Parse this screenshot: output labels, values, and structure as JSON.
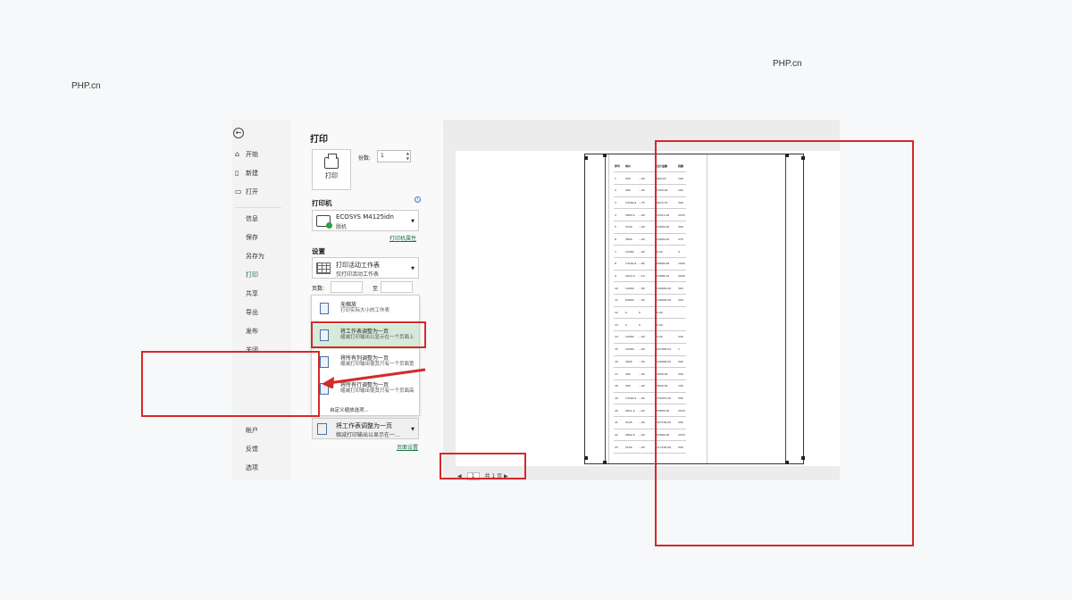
{
  "watermarks": [
    "PHP.cn",
    "PHP.cn"
  ],
  "nav": {
    "back_icon": "back-arrow-icon",
    "top_items": [
      {
        "label": "开始",
        "icon": "home-icon"
      },
      {
        "label": "新建",
        "icon": "new-doc-icon"
      },
      {
        "label": "打开",
        "icon": "folder-open-icon"
      }
    ],
    "items": [
      "信息",
      "保存",
      "另存为",
      "打印",
      "共享",
      "导出",
      "发布",
      "关闭"
    ],
    "active": "打印",
    "bottom_items": [
      "帐户",
      "反馈",
      "选项"
    ]
  },
  "print": {
    "title": "打印",
    "print_button": "打印",
    "copies_label": "份数:",
    "copies_value": "1",
    "printer_header": "打印机",
    "printer_name": "ECOSYS M4125idn",
    "printer_status": "脱机",
    "printer_properties": "打印机属性",
    "settings_header": "设置",
    "scope_title": "打印活动工作表",
    "scope_desc": "仅打印活动工作表",
    "pages_label": "页数:",
    "to_label": "至",
    "scaling_options": [
      {
        "title": "无缩放",
        "desc": "打印实际大小的工作表"
      },
      {
        "title": "将工作表调整为一页",
        "desc": "缩减打印输出以显示在一个页面上"
      },
      {
        "title": "将所有列调整为一页",
        "desc": "缩减打印输出使其只有一个页面宽"
      },
      {
        "title": "将所有行调整为一页",
        "desc": "缩减打印输出使其只有一个页面高"
      }
    ],
    "custom_scaling": "自定义缩放选项...",
    "scaling_selected_title": "将工作表调整为一页",
    "scaling_selected_desc": "缩减打印输出以显示在一...",
    "page_setup": "页面设置"
  },
  "preview": {
    "page_current": "1",
    "page_total_text": "共 1 页",
    "table_header": [
      "序号",
      "单价",
      "",
      "合计金额",
      "税额"
    ],
    "table_rows": [
      [
        "1",
        "300",
        "...00",
        "900.00",
        "100"
      ],
      [
        "2",
        "300",
        "...00",
        "1300.00",
        "100"
      ],
      [
        "3",
        "1316a.9",
        "...75",
        "9974.75",
        "300"
      ],
      [
        "4",
        "2803.9",
        "...90",
        "10511.90",
        "2470"
      ],
      [
        "5",
        "3100",
        "...00",
        "23000.00",
        "300"
      ],
      [
        "6",
        "3800",
        "...00",
        "24000.00",
        "270"
      ],
      [
        "7",
        "12400",
        "...00",
        "0.00",
        "0"
      ],
      [
        "8",
        "1316a.9",
        "...80",
        "99894.80",
        "1000"
      ],
      [
        "9",
        "2012.9",
        "...10",
        "22896.10",
        "5000"
      ],
      [
        "10",
        "14000",
        "...00",
        "140000.00",
        "300"
      ],
      [
        "11",
        "64000",
        "...00",
        "140000.00",
        "300"
      ],
      [
        "12",
        "0",
        "0",
        "0.00",
        ""
      ],
      [
        "13",
        "0",
        "0",
        "0.00",
        ""
      ],
      [
        "14",
        "10000",
        "...00",
        "0.00",
        "240"
      ],
      [
        "15",
        "10000",
        "...00",
        "227000.00",
        "1"
      ],
      [
        "16",
        "3000",
        "...00",
        "140000.00",
        "300"
      ],
      [
        "17",
        "300",
        "...00",
        "3000.00",
        "300"
      ],
      [
        "18",
        "300",
        "...00",
        "4000.00",
        "100"
      ],
      [
        "19",
        "1316a.9",
        "...00",
        "330072.00",
        "300"
      ],
      [
        "20",
        "2811.9",
        "...00",
        "55855.00",
        "2470"
      ],
      [
        "21",
        "3100",
        "...00",
        "167100.00",
        "300"
      ],
      [
        "22",
        "2802.9",
        "...00",
        "97802.90",
        "2470"
      ],
      [
        "23",
        "3100",
        "...00",
        "117100.00",
        "300"
      ]
    ]
  },
  "annotation_color": "#d42a2a",
  "accent_color": "#1f7244"
}
